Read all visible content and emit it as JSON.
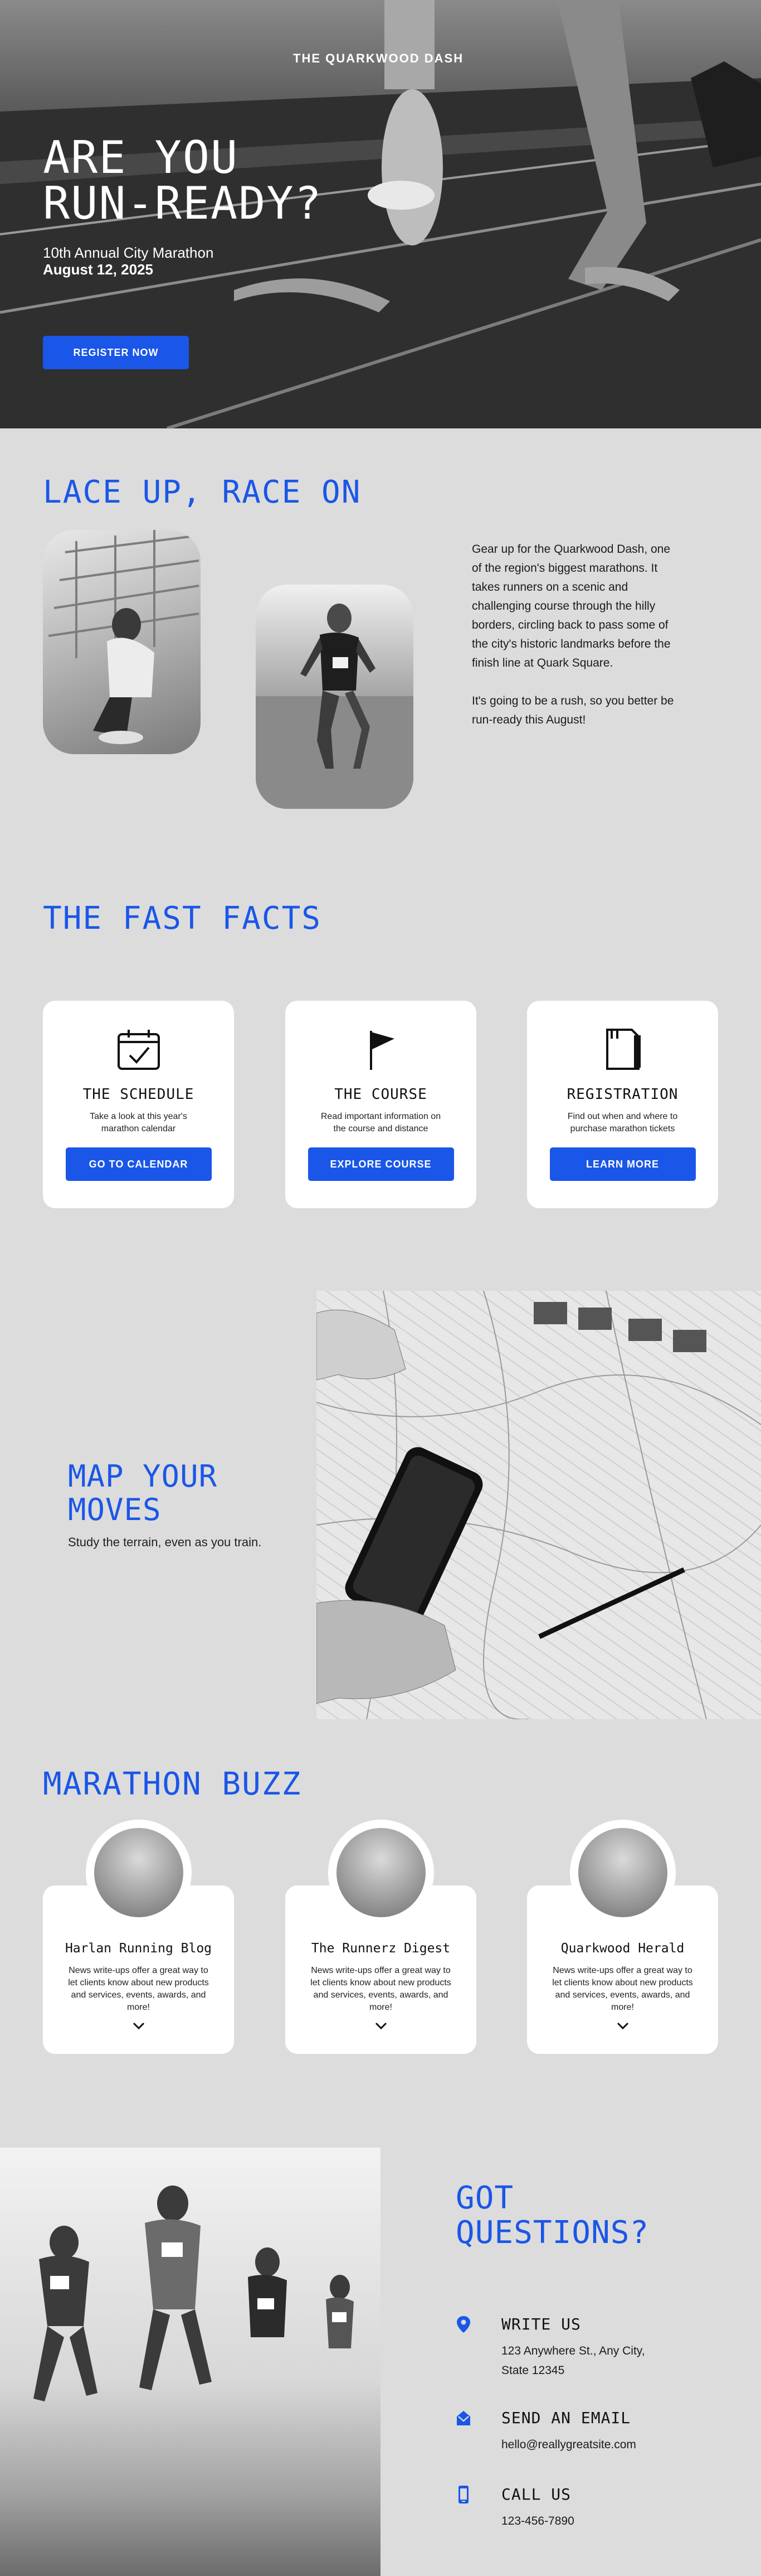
{
  "hero": {
    "site_title": "THE QUARKWOOD DASH",
    "headline_line1": "ARE YOU",
    "headline_line2": "RUN-READY?",
    "subtitle": "10th Annual City Marathon",
    "date": "August 12, 2025",
    "cta_label": "REGISTER NOW"
  },
  "lace_up": {
    "title": "LACE UP, RACE ON",
    "paragraph1": "Gear up for the Quarkwood Dash, one of the region's biggest marathons. It takes runners on a scenic and challenging course through the hilly borders, circling back to pass some of the city's historic landmarks before the finish line at Quark Square.",
    "paragraph2": "It's going to be a rush, so you better be run-ready this August!"
  },
  "facts": {
    "title": "THE FAST FACTS",
    "cards": [
      {
        "icon": "calendar-icon",
        "heading": "THE SCHEDULE",
        "text": "Take a look at this year's marathon calendar",
        "button": "GO TO CALENDAR"
      },
      {
        "icon": "flag-icon",
        "heading": "THE COURSE",
        "text": "Read important information on the course and distance",
        "button": "EXPLORE COURSE"
      },
      {
        "icon": "notebook-icon",
        "heading": "REGISTRATION",
        "text": "Find out when and where to purchase marathon tickets",
        "button": "LEARN MORE"
      }
    ]
  },
  "map": {
    "title_line1": "MAP YOUR",
    "title_line2": "MOVES",
    "subtitle": "Study the terrain, even as you train."
  },
  "buzz": {
    "title": "MARATHON BUZZ",
    "cards": [
      {
        "heading": "Harlan Running Blog",
        "text": "News write-ups offer a great way to let clients know about new products and services, events, awards, and more!"
      },
      {
        "heading": "The Runnerz Digest",
        "text": "News write-ups offer a great way to let clients know about new products and services, events, awards, and more!"
      },
      {
        "heading": "Quarkwood Herald",
        "text": "News write-ups offer a great way to let clients know about new products and services, events, awards, and more!"
      }
    ]
  },
  "contact": {
    "title_line1": "GOT",
    "title_line2": "QUESTIONS?",
    "items": [
      {
        "icon": "location-pin-icon",
        "heading": "WRITE US",
        "line1": "123 Anywhere St., Any City,",
        "line2": "State 12345"
      },
      {
        "icon": "envelope-icon",
        "heading": "SEND AN EMAIL",
        "line1": "hello@reallygreatsite.com",
        "line2": ""
      },
      {
        "icon": "phone-icon",
        "heading": "CALL US",
        "line1": "123-456-7890",
        "line2": ""
      }
    ]
  },
  "colors": {
    "accent": "#1a56e8",
    "background": "#dcdcdc",
    "card": "#ffffff"
  }
}
